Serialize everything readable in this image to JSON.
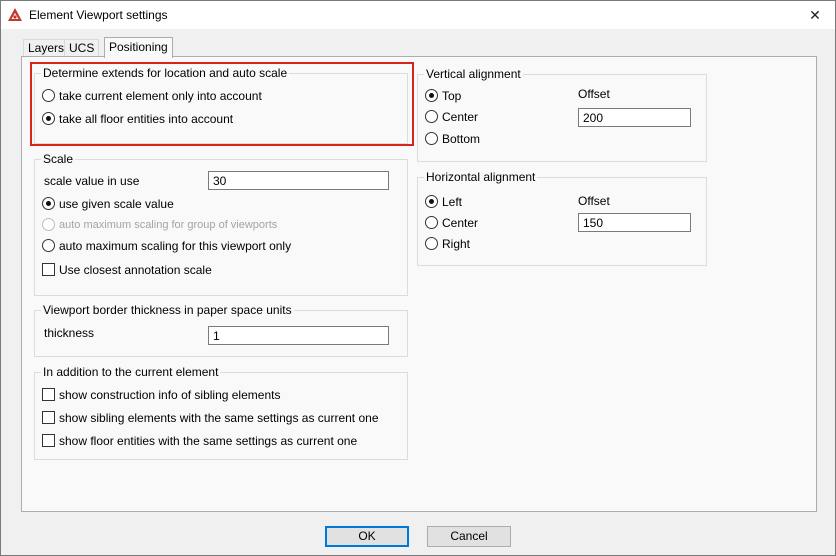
{
  "window": {
    "title": "Element Viewport settings",
    "close_glyph": "✕"
  },
  "tabs": [
    {
      "label": "Layers"
    },
    {
      "label": "UCS"
    },
    {
      "label": "Positioning"
    }
  ],
  "extends": {
    "title": "Determine extends for location and auto scale",
    "option_current": "take current element only into account",
    "option_all_floor": "take all floor entities into account"
  },
  "scale": {
    "title": "Scale",
    "value_label": "scale value in use",
    "value": "30",
    "option_given": "use given scale value",
    "option_auto_group": "auto maximum scaling for group of viewports",
    "option_auto_viewport": "auto maximum scaling for this viewport only",
    "closest_annotation": "Use closest annotation scale"
  },
  "border": {
    "title": "Viewport border thickness in paper space units",
    "thickness_label": "thickness",
    "thickness_value": "1"
  },
  "addition": {
    "title": "In addition to the current element",
    "construction_info": "show construction info of sibling elements",
    "sibling_same": "show sibling elements with the same settings as current one",
    "floor_same": "show floor entities with the same settings as current one"
  },
  "vertical": {
    "title": "Vertical alignment",
    "top": "Top",
    "center": "Center",
    "bottom": "Bottom",
    "offset_label": "Offset",
    "offset_value": "200"
  },
  "horizontal": {
    "title": "Horizontal alignment",
    "left": "Left",
    "center": "Center",
    "right": "Right",
    "offset_label": "Offset",
    "offset_value": "150"
  },
  "buttons": {
    "ok": "OK",
    "cancel": "Cancel"
  },
  "colors": {
    "highlight": "#d9241c",
    "default_button_border": "#0078d7",
    "app_icon": "#c0392b"
  }
}
